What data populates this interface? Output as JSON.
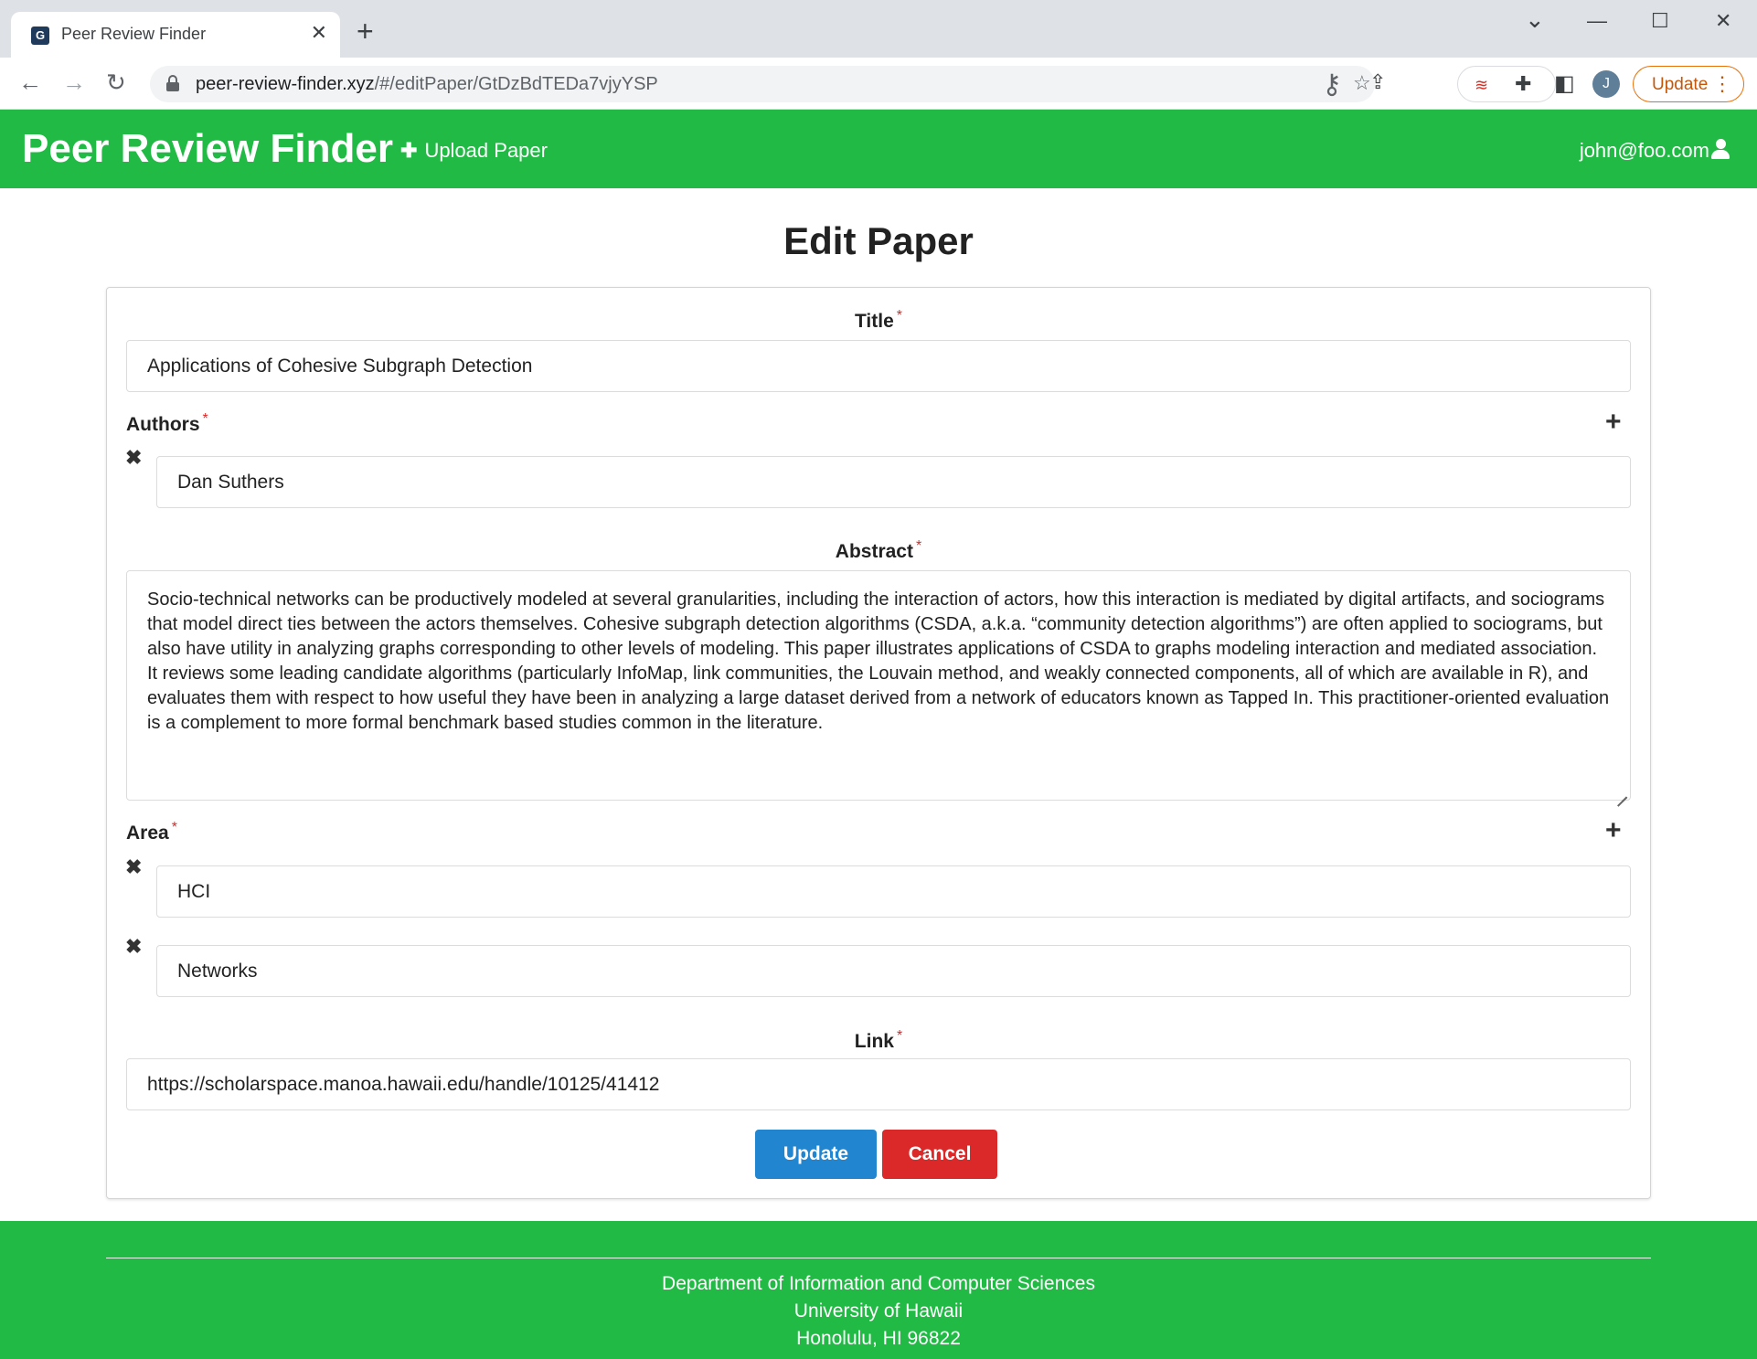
{
  "browser": {
    "tab_title": "Peer Review Finder",
    "tab_close": "✕",
    "new_tab": "+",
    "url_host": "peer-review-finder.xyz",
    "url_path": "/#/editPaper/GtDzBdTEDa7vjyYSP",
    "profile_initial": "J",
    "update_label": "Update",
    "window_min": "—",
    "window_max": "☐",
    "window_close": "✕",
    "tab_list": "⌄"
  },
  "navbar": {
    "brand": "Peer Review Finder",
    "upload_label": "Upload Paper",
    "user_email": "john@foo.com"
  },
  "page": {
    "title": "Edit Paper"
  },
  "form": {
    "title_label": "Title",
    "title_value": "Applications of Cohesive Subgraph Detection",
    "authors_label": "Authors",
    "authors": [
      "Dan Suthers"
    ],
    "abstract_label": "Abstract",
    "abstract_value": "Socio-technical networks can be productively modeled at several granularities, including the interaction of actors, how this interaction is mediated by digital artifacts, and sociograms that model direct ties between the actors themselves. Cohesive subgraph detection algorithms (CSDA, a.k.a. “community detection algorithms”) are often applied to sociograms, but also have utility in analyzing graphs corresponding to other levels of modeling. This paper illustrates applications of CSDA to graphs modeling interaction and mediated association. It reviews some leading candidate algorithms (particularly InfoMap, link communities, the Louvain method, and weakly connected components, all of which are available in R), and evaluates them with respect to how useful they have been in analyzing a large dataset derived from a network of educators known as Tapped In. This practitioner-oriented evaluation is a complement to more formal benchmark based studies common in the literature.",
    "area_label": "Area",
    "areas": [
      "HCI",
      "Networks"
    ],
    "link_label": "Link",
    "link_value": "https://scholarspace.manoa.hawaii.edu/handle/10125/41412",
    "required_mark": "*",
    "update_button": "Update",
    "cancel_button": "Cancel"
  },
  "footer": {
    "line1": "Department of Information and Computer Sciences",
    "line2": "University of Hawaii",
    "line3": "Honolulu, HI 96822"
  },
  "colors": {
    "primary_green": "#21ba45",
    "update_blue": "#2185d0",
    "cancel_red": "#db2828",
    "chrome_update_orange": "#e8710a"
  },
  "icons": {
    "back": "arrow-left-icon",
    "forward": "arrow-right-icon",
    "reload": "reload-icon",
    "lock": "lock-icon",
    "key": "key-icon",
    "share": "share-icon",
    "star": "star-icon",
    "extension": "puzzle-icon",
    "sidepanel": "side-panel-icon",
    "user": "user-icon",
    "add": "plus-icon",
    "remove": "close-icon"
  }
}
